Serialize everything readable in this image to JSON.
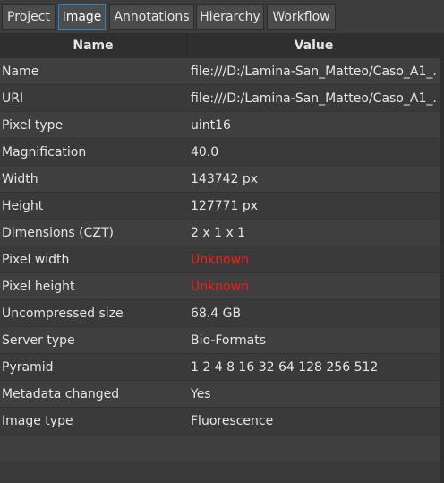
{
  "tabs": [
    {
      "label": "Project",
      "active": false
    },
    {
      "label": "Image",
      "active": true
    },
    {
      "label": "Annotations",
      "active": false
    },
    {
      "label": "Hierarchy",
      "active": false
    },
    {
      "label": "Workflow",
      "active": false
    }
  ],
  "table": {
    "headers": {
      "name": "Name",
      "value": "Value"
    },
    "rows": [
      {
        "name": "Name",
        "value": "file:///D:/Lamina-San_Matteo/Caso_A1_..."
      },
      {
        "name": "URI",
        "value": "file:///D:/Lamina-San_Matteo/Caso_A1_..."
      },
      {
        "name": "Pixel type",
        "value": "uint16"
      },
      {
        "name": "Magnification",
        "value": "40.0"
      },
      {
        "name": "Width",
        "value": "143742 px"
      },
      {
        "name": "Height",
        "value": "127771 px"
      },
      {
        "name": "Dimensions (CZT)",
        "value": "2 x 1 x 1"
      },
      {
        "name": "Pixel width",
        "value": "Unknown",
        "status": "error"
      },
      {
        "name": "Pixel height",
        "value": "Unknown",
        "status": "error"
      },
      {
        "name": "Uncompressed size",
        "value": "68.4 GB"
      },
      {
        "name": "Server type",
        "value": "Bio-Formats"
      },
      {
        "name": "Pyramid",
        "value": "1 2 4 8 16 32 64 128 256 512"
      },
      {
        "name": "Metadata changed",
        "value": "Yes"
      },
      {
        "name": "Image type",
        "value": "Fluorescence"
      },
      {
        "name": "",
        "value": ""
      }
    ]
  },
  "colors": {
    "accent": "#2e84c4",
    "error": "#ff1a1a",
    "background": "#3b3b3b"
  }
}
